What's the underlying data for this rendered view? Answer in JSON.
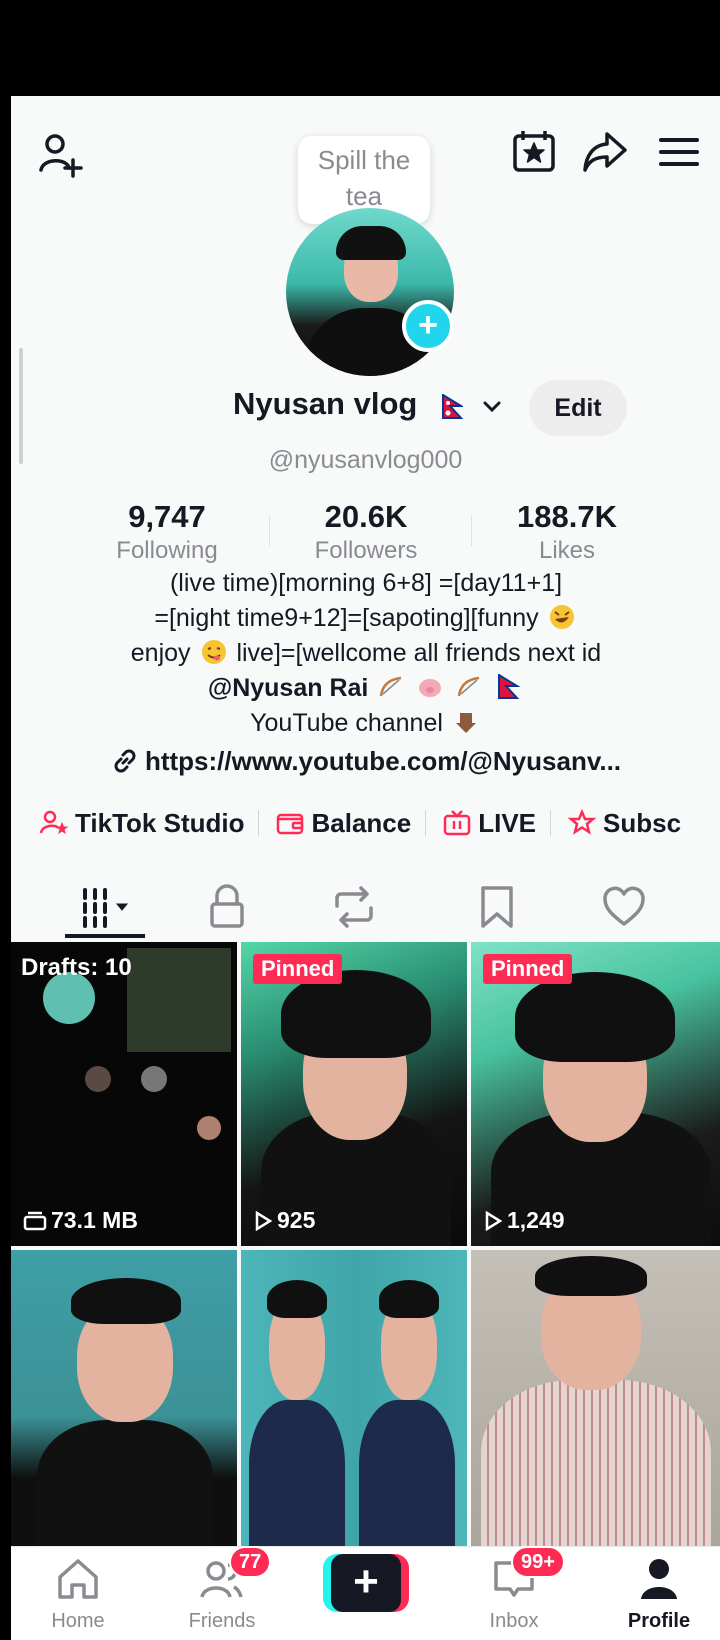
{
  "bubble_text": "Spill the tea",
  "profile": {
    "name": "Nyusan vlog",
    "handle": "@nyusanvlog000",
    "edit_label": "Edit"
  },
  "stats": {
    "following": {
      "value": "9,747",
      "label": "Following"
    },
    "followers": {
      "value": "20.6K",
      "label": "Followers"
    },
    "likes": {
      "value": "188.7K",
      "label": "Likes"
    }
  },
  "bio": {
    "line1": "(live time)[morning 6+8] =[day11+1]",
    "line2": "=[night time9+12]=[sapoting][funny",
    "line3a": "enjoy",
    "line3b": "live]=[wellcome all friends next id",
    "mention": "@Nyusan Rai",
    "line5": "YouTube channel"
  },
  "link": "https://www.youtube.com/@Nyusanv...",
  "shortcuts": [
    {
      "label": "TikTok Studio"
    },
    {
      "label": "Balance"
    },
    {
      "label": "LIVE"
    },
    {
      "label": "Subsc"
    }
  ],
  "grid": {
    "drafts_label": "Drafts: 10",
    "drafts_size": "73.1 MB",
    "pinned_label": "Pinned",
    "views_1": "925",
    "views_2": "1,249"
  },
  "nav": {
    "home": "Home",
    "friends": "Friends",
    "inbox": "Inbox",
    "profile": "Profile",
    "friends_count": "77",
    "inbox_count": "99+"
  },
  "colors": {
    "accent": "#fe2c55",
    "cyan": "#20d5ec",
    "text_primary": "#161823",
    "text_secondary": "#8a8b91"
  }
}
